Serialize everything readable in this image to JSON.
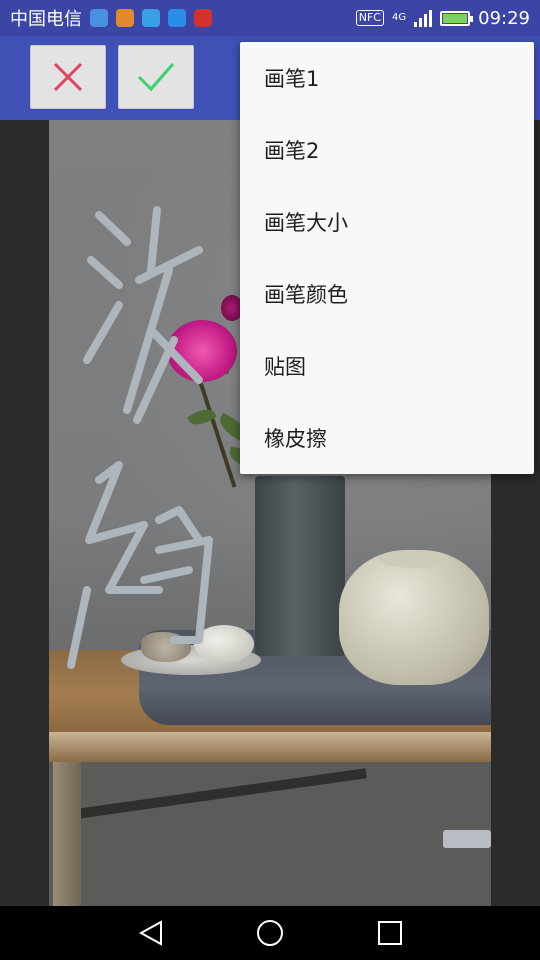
{
  "status_bar": {
    "carrier": "中国电信",
    "notification_icons": [
      {
        "icon": "sogou-input-icon",
        "color": "#4a90e2"
      },
      {
        "icon": "app-orange-icon",
        "color": "#e08a2c"
      },
      {
        "icon": "android-robot-icon",
        "color": "#3aa0e8"
      },
      {
        "icon": "chat-bubble-icon",
        "color": "#2a8ee6"
      },
      {
        "icon": "huawei-logo-icon",
        "color": "#d32f2f"
      }
    ],
    "nfc_label": "NFC",
    "network_label": "4G",
    "time": "09:29"
  },
  "toolbar": {
    "cancel_icon": "close-icon",
    "cancel_color": "#e5405e",
    "confirm_icon": "check-icon",
    "confirm_color": "#3bd16f",
    "background_color": "#3f51b5"
  },
  "menu": {
    "items": [
      {
        "label": "画笔1"
      },
      {
        "label": "画笔2"
      },
      {
        "label": "画笔大小"
      },
      {
        "label": "画笔颜色"
      },
      {
        "label": "贴图"
      },
      {
        "label": "橡皮擦"
      }
    ]
  },
  "nav_bar": {
    "back_icon": "back-triangle-icon",
    "home_icon": "home-circle-icon",
    "recent_icon": "recent-apps-square-icon"
  }
}
